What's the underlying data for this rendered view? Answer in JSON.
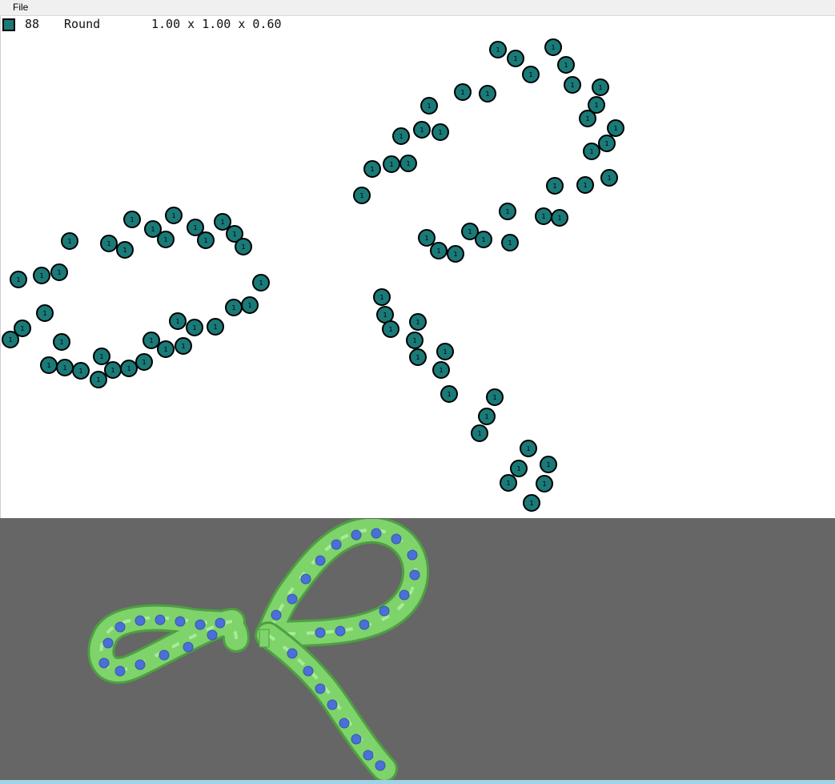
{
  "menubar": {
    "file_label": "File"
  },
  "info": {
    "stone_count": "88",
    "shape": "Round",
    "dimensions": "1.00 x 1.00 x 0.60",
    "stone_color": "#1a7a78"
  },
  "stone_label": "1",
  "viewport": {
    "background_color": "#666666",
    "setting_color": "#7ed36a",
    "gem_color": "#4a6fd8"
  }
}
